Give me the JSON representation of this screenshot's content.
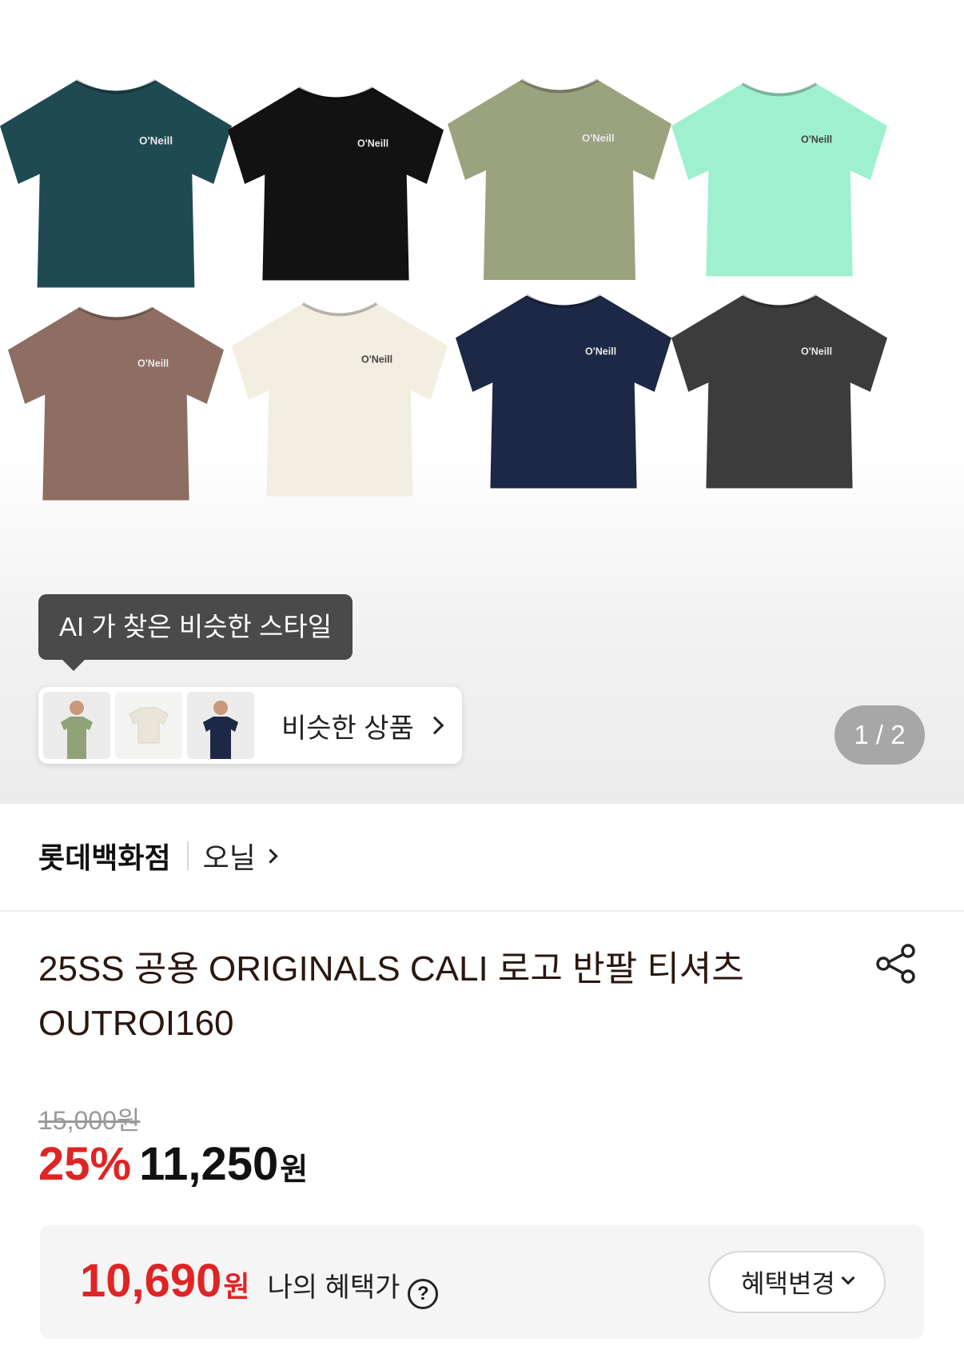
{
  "product_images": {
    "shirts": [
      {
        "color": "#1f4a52",
        "logo": "O'Neill"
      },
      {
        "color": "#121212",
        "logo": "O'Neill"
      },
      {
        "color": "#9ba37e",
        "logo": "O'Neill"
      },
      {
        "color": "#9ff0cf",
        "logo": "O'Neill"
      },
      {
        "color": "#8e6e62",
        "logo": "O'Neill"
      },
      {
        "color": "#f3eee2",
        "logo": "O'Neill"
      },
      {
        "color": "#1c2845",
        "logo": "O'Neill"
      },
      {
        "color": "#3c3c3c",
        "logo": "O'Neill"
      }
    ],
    "pager_text": "1 / 2"
  },
  "ai_style": {
    "tooltip": "AI 가 찾은 비슷한 스타일",
    "similar_label": "비슷한 상품"
  },
  "seller": {
    "store": "롯데백화점",
    "brand": "오닐"
  },
  "product": {
    "title": "25SS 공용 ORIGINALS CALI 로고 반팔 티셔츠 OUTROI160",
    "original_price": "15,000원",
    "discount": "25%",
    "sale_price": "11,250",
    "currency": "원"
  },
  "benefit": {
    "amount": "10,690",
    "currency": "원",
    "label": "나의 혜택가",
    "help_icon": "?",
    "change_button": "혜택변경"
  },
  "colors": {
    "accent_red": "#e02424"
  }
}
